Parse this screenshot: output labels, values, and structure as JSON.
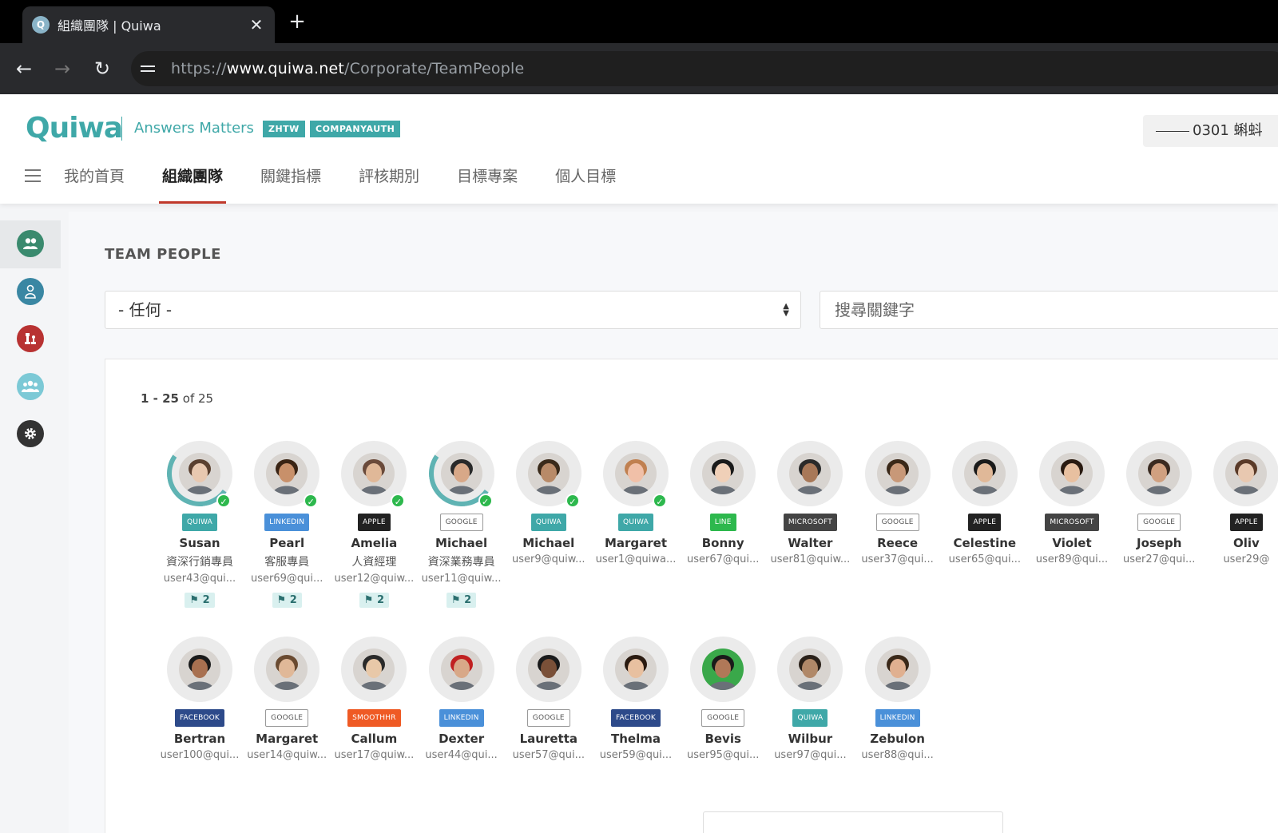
{
  "browser": {
    "tab_title": "組織團隊 | Quiwa",
    "favicon_letter": "Q",
    "url_scheme": "https://",
    "url_host": "www.quiwa.net",
    "url_path": "/Corporate/TeamPeople"
  },
  "header": {
    "logo": "Quiwa",
    "tagline": "Answers Matters",
    "badges": [
      "ZHTW",
      "COMPANYAUTH"
    ],
    "user_chip": "0301 蝌蚪",
    "nav": [
      "我的首頁",
      "組織團隊",
      "關鍵指標",
      "評核期別",
      "目標專案",
      "個人目標"
    ],
    "active_nav": "組織團隊"
  },
  "sidebar": {
    "items": [
      {
        "icon": "team-icon",
        "color": "#3a8a6e"
      },
      {
        "icon": "person-icon",
        "color": "#3a87a3"
      },
      {
        "icon": "chess-icon",
        "color": "#b83232"
      },
      {
        "icon": "group-icon",
        "color": "#7cc9d6"
      },
      {
        "icon": "gear-icon",
        "color": "#333333"
      }
    ]
  },
  "main": {
    "title": "TEAM PEOPLE",
    "filter_value": "- 任何 -",
    "search_placeholder": "搜尋關鍵字",
    "count_range": "1 - 25",
    "count_of": "of",
    "count_total": "25"
  },
  "brands": {
    "QUIWA": {
      "label": "QUIWA",
      "color": "#3fa8a8",
      "outline": false
    },
    "LINKEDIN": {
      "label": "LINKEDIN",
      "color": "#4a90d9",
      "outline": false
    },
    "APPLE": {
      "label": "APPLE",
      "color": "#222222",
      "outline": false
    },
    "GOOGLE": {
      "label": "GOOGLE",
      "color": "#ffffff",
      "outline": true
    },
    "LINE": {
      "label": "LINE",
      "color": "#2db84d",
      "outline": false
    },
    "MICROSOFT": {
      "label": "MICROSOFT",
      "color": "#444444",
      "outline": false
    },
    "FACEBOOK": {
      "label": "FACEBOOK",
      "color": "#2d4a8a",
      "outline": false
    },
    "SMOOTHHR": {
      "label": "SMOOTHHR",
      "color": "#ef5a24",
      "outline": false
    }
  },
  "people_row1": [
    {
      "name": "Susan",
      "title": "資深行銷專員",
      "email": "user43@qui...",
      "brand": "QUIWA",
      "verified": true,
      "flags": "2",
      "skin": "#e8c8b0",
      "hair": "#5a4030",
      "arc": true
    },
    {
      "name": "Pearl",
      "title": "客服專員",
      "email": "user69@qui...",
      "brand": "LINKEDIN",
      "verified": true,
      "flags": "2",
      "skin": "#c8906a",
      "hair": "#3a2414",
      "arc": false
    },
    {
      "name": "Amelia",
      "title": "人資經理",
      "email": "user12@quiw...",
      "brand": "APPLE",
      "verified": true,
      "flags": "2",
      "skin": "#e0b898",
      "hair": "#6a4a3a",
      "arc": false
    },
    {
      "name": "Michael",
      "title": "資深業務專員",
      "email": "user11@quiw...",
      "brand": "GOOGLE",
      "verified": true,
      "flags": "2",
      "skin": "#d8a888",
      "hair": "#2a2a2a",
      "arc": true
    },
    {
      "name": "Michael",
      "title": "",
      "email": "user9@quiw...",
      "brand": "QUIWA",
      "verified": true,
      "flags": "",
      "skin": "#b88a68",
      "hair": "#3a2a1a",
      "arc": false
    },
    {
      "name": "Margaret",
      "title": "",
      "email": "user1@quiwa...",
      "brand": "QUIWA",
      "verified": true,
      "flags": "",
      "skin": "#f0c0a8",
      "hair": "#c08050",
      "arc": false
    },
    {
      "name": "Bonny",
      "title": "",
      "email": "user67@qui...",
      "brand": "LINE",
      "verified": false,
      "flags": "",
      "skin": "#f0d0b8",
      "hair": "#1a1a1a",
      "arc": false
    },
    {
      "name": "Walter",
      "title": "",
      "email": "user81@quiw...",
      "brand": "MICROSOFT",
      "verified": false,
      "flags": "",
      "skin": "#a87858",
      "hair": "#2a2a2a",
      "arc": false
    },
    {
      "name": "Reece",
      "title": "",
      "email": "user37@qui...",
      "brand": "GOOGLE",
      "verified": false,
      "flags": "",
      "skin": "#c89878",
      "hair": "#3a2818",
      "arc": false
    },
    {
      "name": "Celestine",
      "title": "",
      "email": "user65@qui...",
      "brand": "APPLE",
      "verified": false,
      "flags": "",
      "skin": "#e0b898",
      "hair": "#1a1a1a",
      "arc": false
    },
    {
      "name": "Violet",
      "title": "",
      "email": "user89@qui...",
      "brand": "MICROSOFT",
      "verified": false,
      "flags": "",
      "skin": "#e8c0a0",
      "hair": "#2a1a10",
      "arc": false
    },
    {
      "name": "Joseph",
      "title": "",
      "email": "user27@qui...",
      "brand": "GOOGLE",
      "verified": false,
      "flags": "",
      "skin": "#d0a080",
      "hair": "#3a2a20",
      "arc": false
    },
    {
      "name": "Oliv",
      "title": "",
      "email": "user29@",
      "brand": "APPLE",
      "verified": false,
      "flags": "",
      "skin": "#e8c8b0",
      "hair": "#5a3a28",
      "arc": false
    }
  ],
  "people_row2": [
    {
      "name": "Bertran",
      "email": "user100@qui...",
      "brand": "FACEBOOK",
      "skin": "#a87050",
      "hair": "#1a1a1a"
    },
    {
      "name": "Margaret",
      "email": "user14@quiw...",
      "brand": "GOOGLE",
      "skin": "#e0b898",
      "hair": "#6a4a30"
    },
    {
      "name": "Callum",
      "email": "user17@quiw...",
      "brand": "SMOOTHHR",
      "skin": "#e8c8a8",
      "hair": "#2a2a2a"
    },
    {
      "name": "Dexter",
      "email": "user44@qui...",
      "brand": "LINKEDIN",
      "skin": "#d8a888",
      "hair": "#c02020"
    },
    {
      "name": "Lauretta",
      "email": "user57@qui...",
      "brand": "GOOGLE",
      "skin": "#7a5038",
      "hair": "#1a1a1a"
    },
    {
      "name": "Thelma",
      "email": "user59@qui...",
      "brand": "FACEBOOK",
      "skin": "#e8c0a0",
      "hair": "#2a1a10"
    },
    {
      "name": "Bevis",
      "email": "user95@qui...",
      "brand": "GOOGLE",
      "skin": "#b07858",
      "hair": "#1a1a1a",
      "bg": "#3aa84a"
    },
    {
      "name": "Wilbur",
      "email": "user97@qui...",
      "brand": "QUIWA",
      "skin": "#b08868",
      "hair": "#2a2018"
    },
    {
      "name": "Zebulon",
      "email": "user88@qui...",
      "brand": "LINKEDIN",
      "skin": "#e0b090",
      "hair": "#3a2818"
    }
  ]
}
